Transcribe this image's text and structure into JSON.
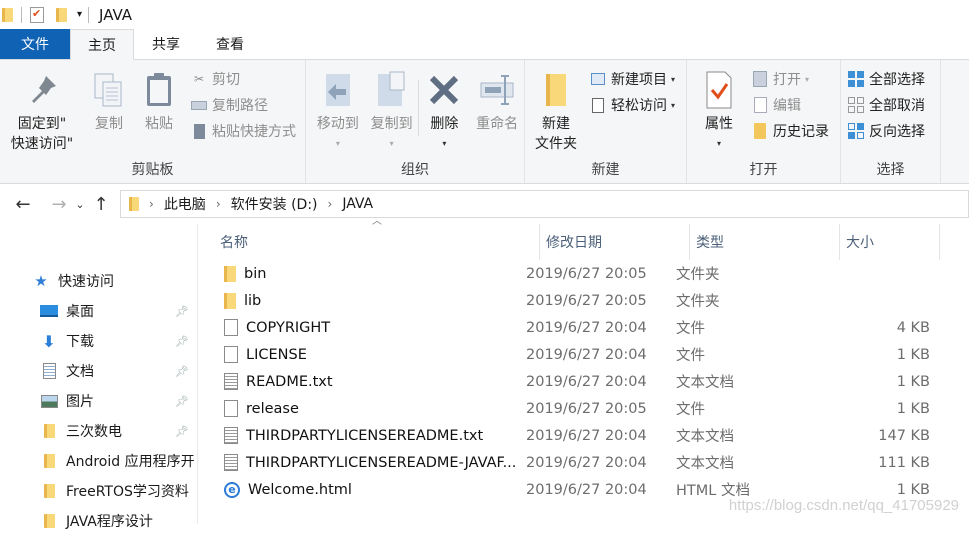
{
  "window": {
    "title": "JAVA"
  },
  "tabs": [
    {
      "label": "文件"
    },
    {
      "label": "主页"
    },
    {
      "label": "共享"
    },
    {
      "label": "查看"
    }
  ],
  "ribbon": {
    "clipboard": {
      "label": "剪贴板",
      "pin_quick_access": "固定到\"快速访问\"",
      "pin_line1": "固定到\"",
      "pin_line2": "快速访问\"",
      "copy": "复制",
      "paste": "粘贴",
      "cut": "剪切",
      "copy_path": "复制路径",
      "paste_shortcut": "粘贴快捷方式"
    },
    "organize": {
      "label": "组织",
      "move_to": "移动到",
      "copy_to": "复制到",
      "delete": "删除",
      "rename": "重命名"
    },
    "new": {
      "label": "新建",
      "new_folder_line1": "新建",
      "new_folder_line2": "文件夹",
      "new_item": "新建项目",
      "easy_access": "轻松访问"
    },
    "open": {
      "label": "打开",
      "properties": "属性",
      "open": "打开",
      "edit": "编辑",
      "history": "历史记录"
    },
    "select": {
      "label": "选择",
      "select_all": "全部选择",
      "select_none": "全部取消",
      "invert": "反向选择"
    }
  },
  "address": {
    "crumbs": [
      "此电脑",
      "软件安装 (D:)",
      "JAVA"
    ]
  },
  "sidebar": {
    "quick_access": "快速访问",
    "items": [
      {
        "label": "桌面",
        "icon": "desktop-icon",
        "pinned": true
      },
      {
        "label": "下载",
        "icon": "download-icon",
        "pinned": true
      },
      {
        "label": "文档",
        "icon": "documents-icon",
        "pinned": true
      },
      {
        "label": "图片",
        "icon": "pictures-icon",
        "pinned": true
      },
      {
        "label": "三次数电",
        "icon": "folder-icon",
        "pinned": true
      },
      {
        "label": "Android 应用程序开",
        "icon": "folder-icon",
        "pinned": false
      },
      {
        "label": "FreeRTOS学习资料",
        "icon": "folder-icon",
        "pinned": false
      },
      {
        "label": "JAVA程序设计",
        "icon": "folder-icon",
        "pinned": false
      }
    ]
  },
  "columns": {
    "name": "名称",
    "date": "修改日期",
    "type": "类型",
    "size": "大小"
  },
  "files": [
    {
      "name": "bin",
      "date": "2019/6/27 20:05",
      "type": "文件夹",
      "size": "",
      "icon": "folder"
    },
    {
      "name": "lib",
      "date": "2019/6/27 20:05",
      "type": "文件夹",
      "size": "",
      "icon": "folder"
    },
    {
      "name": "COPYRIGHT",
      "date": "2019/6/27 20:04",
      "type": "文件",
      "size": "4 KB",
      "icon": "file"
    },
    {
      "name": "LICENSE",
      "date": "2019/6/27 20:04",
      "type": "文件",
      "size": "1 KB",
      "icon": "file"
    },
    {
      "name": "README.txt",
      "date": "2019/6/27 20:04",
      "type": "文本文档",
      "size": "1 KB",
      "icon": "text"
    },
    {
      "name": "release",
      "date": "2019/6/27 20:05",
      "type": "文件",
      "size": "1 KB",
      "icon": "file"
    },
    {
      "name": "THIRDPARTYLICENSEREADME.txt",
      "date": "2019/6/27 20:04",
      "type": "文本文档",
      "size": "147 KB",
      "icon": "text"
    },
    {
      "name": "THIRDPARTYLICENSEREADME-JAVAF...",
      "date": "2019/6/27 20:04",
      "type": "文本文档",
      "size": "111 KB",
      "icon": "text"
    },
    {
      "name": "Welcome.html",
      "date": "2019/6/27 20:04",
      "type": "HTML 文档",
      "size": "1 KB",
      "icon": "ie"
    }
  ],
  "watermark": "https://blog.csdn.net/qq_41705929"
}
